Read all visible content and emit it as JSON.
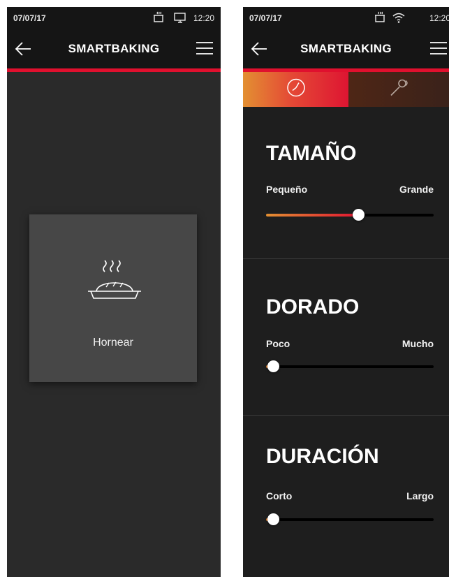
{
  "screen_left": {
    "status": {
      "date": "07/07/17",
      "time": "12:20"
    },
    "header": {
      "title": "SMARTBAKING"
    },
    "mode": {
      "label": "Hornear",
      "icon": "bread-baking-icon"
    }
  },
  "screen_right": {
    "status": {
      "date": "07/07/17",
      "time": "12:20"
    },
    "header": {
      "title": "SMARTBAKING"
    },
    "tabs": [
      {
        "icon": "timer-icon",
        "active": true
      },
      {
        "icon": "food-probe-icon",
        "active": false
      }
    ],
    "settings": [
      {
        "title": "TAMAÑO",
        "min_label": "Pequeño",
        "max_label": "Grande",
        "value": 0.55
      },
      {
        "title": "DORADO",
        "min_label": "Poco",
        "max_label": "Mucho",
        "value": 0.04
      },
      {
        "title": "DURACIÓN",
        "min_label": "Corto",
        "max_label": "Largo",
        "value": 0.04
      }
    ]
  },
  "colors": {
    "accent_red": "#e0102e",
    "accent_orange": "#e39032",
    "background": "#1e1e1e"
  }
}
